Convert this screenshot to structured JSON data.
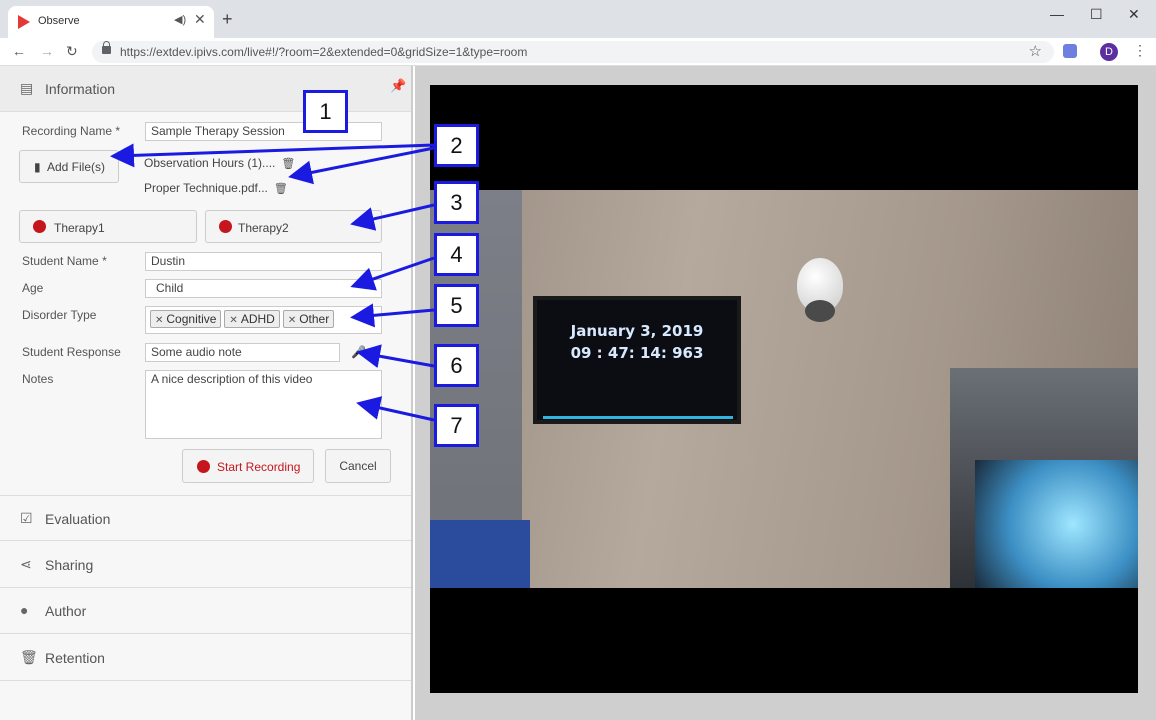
{
  "browser": {
    "tab_title": "Observe",
    "tab_audio_icon": "audio-icon",
    "tab_close": "✕",
    "new_tab": "+",
    "url": "https://extdev.ipivs.com/live#!/?room=2&extended=0&gridSize=1&type=room",
    "profile_initial": "D",
    "window_controls": [
      "—",
      "☐",
      "✕"
    ]
  },
  "panel": {
    "title": "Information",
    "recording_name": {
      "label": "Recording Name",
      "required": "*",
      "value": "Sample Therapy Session"
    },
    "add_files_label": "Add File(s)",
    "files": [
      "Observation Hours (1)....",
      "Proper Technique.pdf..."
    ],
    "therapy_buttons": [
      "Therapy1",
      "Therapy2"
    ],
    "student_name": {
      "label": "Student Name",
      "required": "*",
      "value": "Dustin"
    },
    "age": {
      "label": "Age",
      "value": "Child"
    },
    "disorder_type": {
      "label": "Disorder Type",
      "tags": [
        "Cognitive",
        "ADHD",
        "Other"
      ]
    },
    "student_response": {
      "label": "Student Response",
      "value": "Some audio note"
    },
    "notes": {
      "label": "Notes",
      "value": "A nice description of this video"
    },
    "start_recording_label": "Start Recording",
    "cancel_label": "Cancel",
    "sections": [
      {
        "title": "Evaluation",
        "icon": "checkbox-icon"
      },
      {
        "title": "Sharing",
        "icon": "share-icon"
      },
      {
        "title": "Author",
        "icon": "user-icon"
      },
      {
        "title": "Retention",
        "icon": "trash-icon"
      }
    ]
  },
  "video": {
    "tv_date": "January 3, 2019",
    "tv_time": "09 : 47: 14: 963"
  },
  "annotations": [
    "1",
    "2",
    "3",
    "4",
    "5",
    "6",
    "7"
  ],
  "colors": {
    "annotation": "#1a1ae0",
    "record": "#c4161c",
    "start_recording_text": "#c4161c"
  }
}
